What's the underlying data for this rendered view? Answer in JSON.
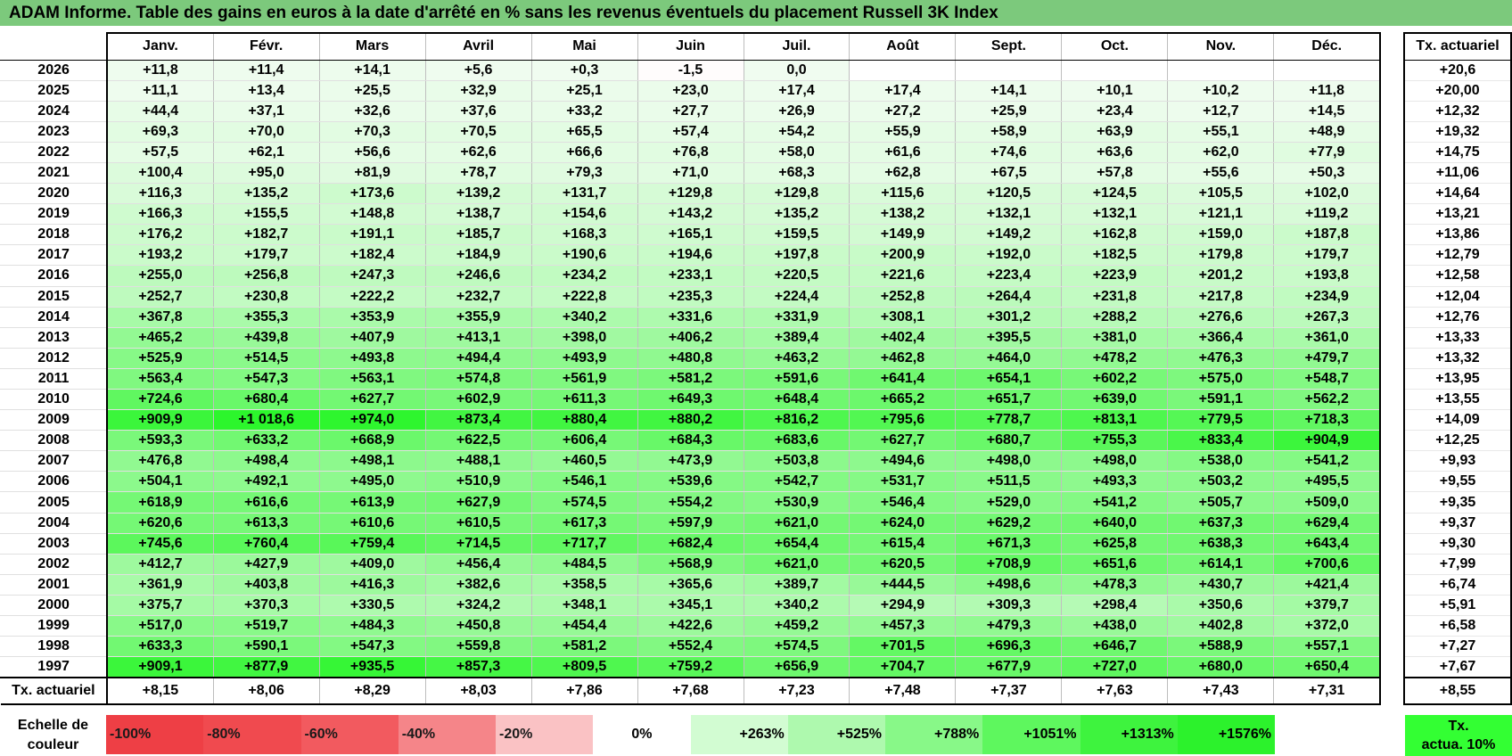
{
  "title": "ADAM Informe. Table des gains en euros à la date d'arrêté en % sans les revenus éventuels du placement Russell 3K Index",
  "months": [
    "Janv.",
    "Févr.",
    "Mars",
    "Avril",
    "Mai",
    "Juin",
    "Juil.",
    "Août",
    "Sept.",
    "Oct.",
    "Nov.",
    "Déc."
  ],
  "rate_header": "Tx. actuariel",
  "rows": [
    {
      "year": "2026",
      "values": [
        "+11,8",
        "+11,4",
        "+14,1",
        "+5,6",
        "+0,3",
        "-1,5",
        "0,0",
        "",
        "",
        "",
        "",
        ""
      ],
      "rate": "+20,6"
    },
    {
      "year": "2025",
      "values": [
        "+11,1",
        "+13,4",
        "+25,5",
        "+32,9",
        "+25,1",
        "+23,0",
        "+17,4",
        "+17,4",
        "+14,1",
        "+10,1",
        "+10,2",
        "+11,8"
      ],
      "rate": "+20,00"
    },
    {
      "year": "2024",
      "values": [
        "+44,4",
        "+37,1",
        "+32,6",
        "+37,6",
        "+33,2",
        "+27,7",
        "+26,9",
        "+27,2",
        "+25,9",
        "+23,4",
        "+12,7",
        "+14,5"
      ],
      "rate": "+12,32"
    },
    {
      "year": "2023",
      "values": [
        "+69,3",
        "+70,0",
        "+70,3",
        "+70,5",
        "+65,5",
        "+57,4",
        "+54,2",
        "+55,9",
        "+58,9",
        "+63,9",
        "+55,1",
        "+48,9"
      ],
      "rate": "+19,32"
    },
    {
      "year": "2022",
      "values": [
        "+57,5",
        "+62,1",
        "+56,6",
        "+62,6",
        "+66,6",
        "+76,8",
        "+58,0",
        "+61,6",
        "+74,6",
        "+63,6",
        "+62,0",
        "+77,9"
      ],
      "rate": "+14,75"
    },
    {
      "year": "2021",
      "values": [
        "+100,4",
        "+95,0",
        "+81,9",
        "+78,7",
        "+79,3",
        "+71,0",
        "+68,3",
        "+62,8",
        "+67,5",
        "+57,8",
        "+55,6",
        "+50,3"
      ],
      "rate": "+11,06"
    },
    {
      "year": "2020",
      "values": [
        "+116,3",
        "+135,2",
        "+173,6",
        "+139,2",
        "+131,7",
        "+129,8",
        "+129,8",
        "+115,6",
        "+120,5",
        "+124,5",
        "+105,5",
        "+102,0"
      ],
      "rate": "+14,64"
    },
    {
      "year": "2019",
      "values": [
        "+166,3",
        "+155,5",
        "+148,8",
        "+138,7",
        "+154,6",
        "+143,2",
        "+135,2",
        "+138,2",
        "+132,1",
        "+132,1",
        "+121,1",
        "+119,2"
      ],
      "rate": "+13,21"
    },
    {
      "year": "2018",
      "values": [
        "+176,2",
        "+182,7",
        "+191,1",
        "+185,7",
        "+168,3",
        "+165,1",
        "+159,5",
        "+149,9",
        "+149,2",
        "+162,8",
        "+159,0",
        "+187,8"
      ],
      "rate": "+13,86"
    },
    {
      "year": "2017",
      "values": [
        "+193,2",
        "+179,7",
        "+182,4",
        "+184,9",
        "+190,6",
        "+194,6",
        "+197,8",
        "+200,9",
        "+192,0",
        "+182,5",
        "+179,8",
        "+179,7"
      ],
      "rate": "+12,79"
    },
    {
      "year": "2016",
      "values": [
        "+255,0",
        "+256,8",
        "+247,3",
        "+246,6",
        "+234,2",
        "+233,1",
        "+220,5",
        "+221,6",
        "+223,4",
        "+223,9",
        "+201,2",
        "+193,8"
      ],
      "rate": "+12,58"
    },
    {
      "year": "2015",
      "values": [
        "+252,7",
        "+230,8",
        "+222,2",
        "+232,7",
        "+222,8",
        "+235,3",
        "+224,4",
        "+252,8",
        "+264,4",
        "+231,8",
        "+217,8",
        "+234,9"
      ],
      "rate": "+12,04"
    },
    {
      "year": "2014",
      "values": [
        "+367,8",
        "+355,3",
        "+353,9",
        "+355,9",
        "+340,2",
        "+331,6",
        "+331,9",
        "+308,1",
        "+301,2",
        "+288,2",
        "+276,6",
        "+267,3"
      ],
      "rate": "+12,76"
    },
    {
      "year": "2013",
      "values": [
        "+465,2",
        "+439,8",
        "+407,9",
        "+413,1",
        "+398,0",
        "+406,2",
        "+389,4",
        "+402,4",
        "+395,5",
        "+381,0",
        "+366,4",
        "+361,0"
      ],
      "rate": "+13,33"
    },
    {
      "year": "2012",
      "values": [
        "+525,9",
        "+514,5",
        "+493,8",
        "+494,4",
        "+493,9",
        "+480,8",
        "+463,2",
        "+462,8",
        "+464,0",
        "+478,2",
        "+476,3",
        "+479,7"
      ],
      "rate": "+13,32"
    },
    {
      "year": "2011",
      "values": [
        "+563,4",
        "+547,3",
        "+563,1",
        "+574,8",
        "+561,9",
        "+581,2",
        "+591,6",
        "+641,4",
        "+654,1",
        "+602,2",
        "+575,0",
        "+548,7"
      ],
      "rate": "+13,95"
    },
    {
      "year": "2010",
      "values": [
        "+724,6",
        "+680,4",
        "+627,7",
        "+602,9",
        "+611,3",
        "+649,3",
        "+648,4",
        "+665,2",
        "+651,7",
        "+639,0",
        "+591,1",
        "+562,2"
      ],
      "rate": "+13,55"
    },
    {
      "year": "2009",
      "values": [
        "+909,9",
        "+1 018,6",
        "+974,0",
        "+873,4",
        "+880,4",
        "+880,2",
        "+816,2",
        "+795,6",
        "+778,7",
        "+813,1",
        "+779,5",
        "+718,3"
      ],
      "rate": "+14,09"
    },
    {
      "year": "2008",
      "values": [
        "+593,3",
        "+633,2",
        "+668,9",
        "+622,5",
        "+606,4",
        "+684,3",
        "+683,6",
        "+627,7",
        "+680,7",
        "+755,3",
        "+833,4",
        "+904,9"
      ],
      "rate": "+12,25"
    },
    {
      "year": "2007",
      "values": [
        "+476,8",
        "+498,4",
        "+498,1",
        "+488,1",
        "+460,5",
        "+473,9",
        "+503,8",
        "+494,6",
        "+498,0",
        "+498,0",
        "+538,0",
        "+541,2"
      ],
      "rate": "+9,93"
    },
    {
      "year": "2006",
      "values": [
        "+504,1",
        "+492,1",
        "+495,0",
        "+510,9",
        "+546,1",
        "+539,6",
        "+542,7",
        "+531,7",
        "+511,5",
        "+493,3",
        "+503,2",
        "+495,5"
      ],
      "rate": "+9,55"
    },
    {
      "year": "2005",
      "values": [
        "+618,9",
        "+616,6",
        "+613,9",
        "+627,9",
        "+574,5",
        "+554,2",
        "+530,9",
        "+546,4",
        "+529,0",
        "+541,2",
        "+505,7",
        "+509,0"
      ],
      "rate": "+9,35"
    },
    {
      "year": "2004",
      "values": [
        "+620,6",
        "+613,3",
        "+610,6",
        "+610,5",
        "+617,3",
        "+597,9",
        "+621,0",
        "+624,0",
        "+629,2",
        "+640,0",
        "+637,3",
        "+629,4"
      ],
      "rate": "+9,37"
    },
    {
      "year": "2003",
      "values": [
        "+745,6",
        "+760,4",
        "+759,4",
        "+714,5",
        "+717,7",
        "+682,4",
        "+654,4",
        "+615,4",
        "+671,3",
        "+625,8",
        "+638,3",
        "+643,4"
      ],
      "rate": "+9,30"
    },
    {
      "year": "2002",
      "values": [
        "+412,7",
        "+427,9",
        "+409,0",
        "+456,4",
        "+484,5",
        "+568,9",
        "+621,0",
        "+620,5",
        "+708,9",
        "+651,6",
        "+614,1",
        "+700,6"
      ],
      "rate": "+7,99"
    },
    {
      "year": "2001",
      "values": [
        "+361,9",
        "+403,8",
        "+416,3",
        "+382,6",
        "+358,5",
        "+365,6",
        "+389,7",
        "+444,5",
        "+498,6",
        "+478,3",
        "+430,7",
        "+421,4"
      ],
      "rate": "+6,74"
    },
    {
      "year": "2000",
      "values": [
        "+375,7",
        "+370,3",
        "+330,5",
        "+324,2",
        "+348,1",
        "+345,1",
        "+340,2",
        "+294,9",
        "+309,3",
        "+298,4",
        "+350,6",
        "+379,7"
      ],
      "rate": "+5,91"
    },
    {
      "year": "1999",
      "values": [
        "+517,0",
        "+519,7",
        "+484,3",
        "+450,8",
        "+454,4",
        "+422,6",
        "+459,2",
        "+457,3",
        "+479,3",
        "+438,0",
        "+402,8",
        "+372,0"
      ],
      "rate": "+6,58"
    },
    {
      "year": "1998",
      "values": [
        "+633,3",
        "+590,1",
        "+547,3",
        "+559,8",
        "+581,2",
        "+552,4",
        "+574,5",
        "+701,5",
        "+696,3",
        "+646,7",
        "+588,9",
        "+557,1"
      ],
      "rate": "+7,27"
    },
    {
      "year": "1997",
      "values": [
        "+909,1",
        "+877,9",
        "+935,5",
        "+857,3",
        "+809,5",
        "+759,2",
        "+656,9",
        "+704,7",
        "+677,9",
        "+727,0",
        "+680,0",
        "+650,4"
      ],
      "rate": "+7,67"
    }
  ],
  "footer": {
    "label": "Tx. actuariel",
    "values": [
      "+8,15",
      "+8,06",
      "+8,29",
      "+8,03",
      "+7,86",
      "+7,68",
      "+7,23",
      "+7,48",
      "+7,37",
      "+7,63",
      "+7,43",
      "+7,31"
    ],
    "rate": "+8,55"
  },
  "legend": {
    "label": "Echelle de couleur",
    "steps": [
      {
        "label": "-100%",
        "color": "#ee3f45"
      },
      {
        "label": "-80%",
        "color": "#f04a4f"
      },
      {
        "label": "-60%",
        "color": "#f25a5f"
      },
      {
        "label": "-40%",
        "color": "#f58589"
      },
      {
        "label": "-20%",
        "color": "#fac2c4"
      },
      {
        "label": "0%",
        "color": "#ffffff"
      },
      {
        "label": "+263%",
        "color": "#d2fcd2"
      },
      {
        "label": "+525%",
        "color": "#aef9ae"
      },
      {
        "label": "+788%",
        "color": "#88f888"
      },
      {
        "label": "+1051%",
        "color": "#5ef75e"
      },
      {
        "label": "+1313%",
        "color": "#3ef33e"
      },
      {
        "label": "+1576%",
        "color": "#2cf22c"
      }
    ],
    "rate_label": "Tx. actua. 10%",
    "rate_color": "#33ff33"
  },
  "colors": {
    "title_bg": "#7cc97c",
    "cell_green": "#5ef75e",
    "cell_white": "#ffffff",
    "cell_red": "#f25a5f"
  }
}
